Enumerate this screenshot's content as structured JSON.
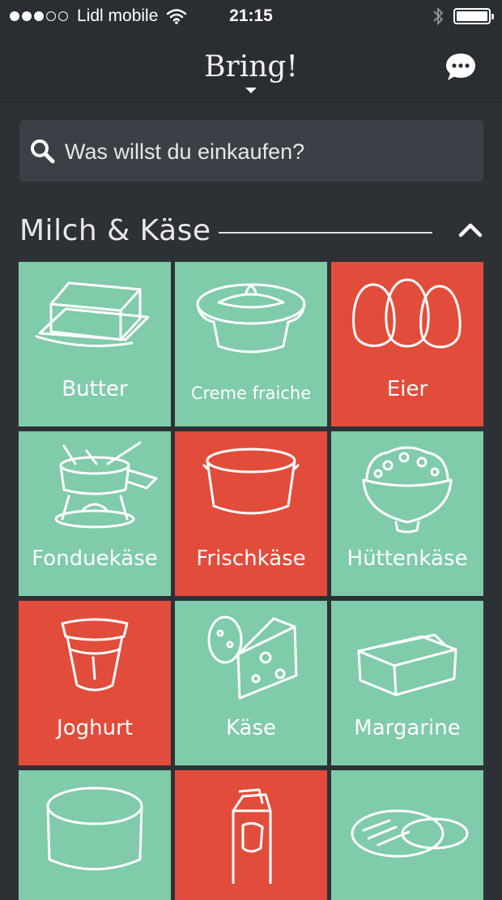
{
  "status_bar": {
    "carrier": "Lidl mobile",
    "time": "21:15",
    "signal_bars": "3 of 5",
    "battery_level": 1.0
  },
  "nav": {
    "title": "Bring!",
    "chat_icon": "chat-bubble-icon"
  },
  "search": {
    "placeholder": "Was willst du einkaufen?",
    "icon": "search-icon"
  },
  "section": {
    "title": "Milch & Käse",
    "collapse_icon": "chevron-up-icon"
  },
  "colors": {
    "background": "#2d3136",
    "tile_green": "#80cba9",
    "tile_red": "#e24c3b"
  },
  "items": [
    {
      "label": "Butter",
      "color": "green",
      "icon": "butter-icon"
    },
    {
      "label": "Creme fraiche",
      "color": "green",
      "icon": "creme-fraiche-icon"
    },
    {
      "label": "Eier",
      "color": "red",
      "icon": "eggs-icon"
    },
    {
      "label": "Fonduekäse",
      "color": "green",
      "icon": "fondue-icon"
    },
    {
      "label": "Frischkäse",
      "color": "red",
      "icon": "cream-cheese-tub-icon"
    },
    {
      "label": "Hüttenkäse",
      "color": "green",
      "icon": "cottage-cheese-bowl-icon"
    },
    {
      "label": "Joghurt",
      "color": "red",
      "icon": "yogurt-cup-icon"
    },
    {
      "label": "Käse",
      "color": "green",
      "icon": "cheese-icon"
    },
    {
      "label": "Margarine",
      "color": "green",
      "icon": "margarine-icon"
    },
    {
      "label": "",
      "color": "green",
      "icon": "tub-icon"
    },
    {
      "label": "",
      "color": "red",
      "icon": "milk-carton-icon"
    },
    {
      "label": "",
      "color": "green",
      "icon": "mozzarella-icon"
    }
  ]
}
